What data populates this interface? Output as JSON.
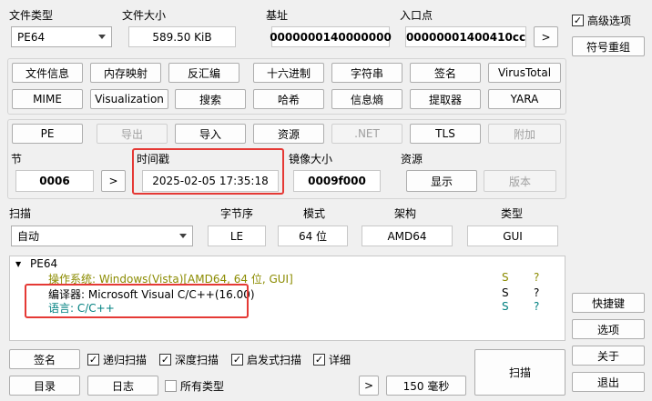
{
  "colors": {
    "os_text": "#8b8b00",
    "lang_text": "#008080",
    "compiler_text": "#000000",
    "highlight": "#e53935"
  },
  "top": {
    "file_type_label": "文件类型",
    "file_type_value": "PE64",
    "file_size_label": "文件大小",
    "file_size_value": "589.50 KiB",
    "base_label": "基址",
    "base_value": "0000000140000000",
    "entry_label": "入口点",
    "entry_value": "00000001400410cc",
    "entry_more": ">"
  },
  "right": {
    "advanced_label": "高级选项",
    "symbol_rebuild": "符号重组",
    "shortcuts": "快捷键",
    "options": "选项",
    "about": "关于",
    "exit": "退出"
  },
  "tools_row1": [
    "文件信息",
    "内存映射",
    "反汇编",
    "十六进制",
    "字符串",
    "签名",
    "VirusTotal"
  ],
  "tools_row2": [
    "MIME",
    "Visualization",
    "搜索",
    "哈希",
    "信息熵",
    "提取器",
    "YARA"
  ],
  "pe_row": {
    "pe": "PE",
    "export": "导出",
    "import": "导入",
    "resources": "资源",
    "net": ".NET",
    "tls": "TLS",
    "overlay": "附加"
  },
  "sections": {
    "section_label": "节",
    "section_value": "0006",
    "section_more": ">",
    "timestamp_label": "时间戳",
    "timestamp_value": "2025-02-05 17:35:18",
    "image_size_label": "镜像大小",
    "image_size_value": "0009f000",
    "resources_label": "资源",
    "show_button": "显示",
    "version_button": "版本"
  },
  "scan_settings": {
    "scan_label": "扫描",
    "scan_value": "自动",
    "endian_label": "字节序",
    "endian_value": "LE",
    "mode_label": "模式",
    "mode_value": "64 位",
    "arch_label": "架构",
    "arch_value": "AMD64",
    "type_label": "类型",
    "type_value": "GUI"
  },
  "results": {
    "root": "PE64",
    "rows": [
      {
        "text": "操作系统: Windows(Vista)[AMD64, 64 位, GUI]",
        "s": "S",
        "q": "?"
      },
      {
        "text": "编译器: Microsoft Visual C/C++(16.00)",
        "s": "S",
        "q": "?"
      },
      {
        "text": "语言: C/C++",
        "s": "S",
        "q": "?"
      }
    ]
  },
  "bottom": {
    "signature": "签名",
    "recursive": "递归扫描",
    "deep": "深度扫描",
    "heuristic": "启发式扫描",
    "verbose": "详细",
    "directory": "目录",
    "log": "日志",
    "all_types": "所有类型",
    "more": ">",
    "time": "150 毫秒",
    "scan": "扫描"
  }
}
